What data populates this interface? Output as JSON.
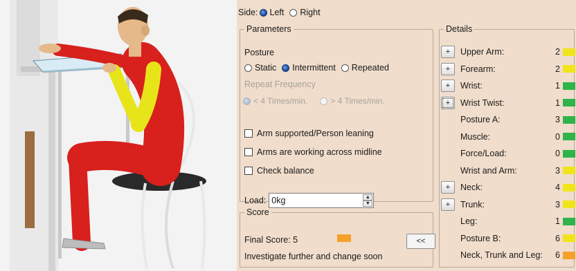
{
  "side": {
    "label": "Side:",
    "options": [
      {
        "label": "Left",
        "selected": true
      },
      {
        "label": "Right",
        "selected": false
      }
    ]
  },
  "parameters": {
    "legend": "Parameters",
    "posture": {
      "label": "Posture",
      "options": [
        {
          "label": "Static",
          "selected": false
        },
        {
          "label": "Intermittent",
          "selected": true
        },
        {
          "label": "Repeated",
          "selected": false
        }
      ]
    },
    "repeat_frequency": {
      "label": "Repeat Frequency",
      "enabled": false,
      "options": [
        {
          "label": "< 4 Times/min.",
          "selected": true
        },
        {
          "label": "> 4 Times/min.",
          "selected": false
        }
      ]
    },
    "checks": [
      {
        "label": "Arm supported/Person leaning",
        "checked": false
      },
      {
        "label": "Arms are working across midline",
        "checked": false
      },
      {
        "label": "Check balance",
        "checked": false
      }
    ],
    "load": {
      "label": "Load:",
      "value": "0kg"
    }
  },
  "score": {
    "legend": "Score",
    "final_label": "Final Score: 5",
    "color": "#f4a12c",
    "message": "Investigate further and change soon",
    "collapse_label": "<<"
  },
  "details": {
    "legend": "Details",
    "items": [
      {
        "label": "Upper Arm:",
        "value": "2",
        "color": "#f2e41b",
        "has_button": true
      },
      {
        "label": "Forearm:",
        "value": "2",
        "color": "#f2e41b",
        "has_button": true
      },
      {
        "label": "Wrist:",
        "value": "1",
        "color": "#2fb34a",
        "has_button": true
      },
      {
        "label": "Wrist Twist:",
        "value": "1",
        "color": "#2fb34a",
        "has_button": true,
        "focused": true
      },
      {
        "label": "Posture A:",
        "value": "3",
        "color": "#2fb34a",
        "has_button": false
      },
      {
        "label": "Muscle:",
        "value": "0",
        "color": "#2fb34a",
        "has_button": false
      },
      {
        "label": "Force/Load:",
        "value": "0",
        "color": "#2fb34a",
        "has_button": false
      },
      {
        "label": "Wrist and Arm:",
        "value": "3",
        "color": "#f2e41b",
        "has_button": false
      },
      {
        "label": "Neck:",
        "value": "4",
        "color": "#f2e41b",
        "has_button": true
      },
      {
        "label": "Trunk:",
        "value": "3",
        "color": "#f2e41b",
        "has_button": true
      },
      {
        "label": "Leg:",
        "value": "1",
        "color": "#2fb34a",
        "has_button": false
      },
      {
        "label": "Posture B:",
        "value": "6",
        "color": "#f2e41b",
        "has_button": false
      },
      {
        "label": "Neck, Trunk and Leg:",
        "value": "6",
        "color": "#f4a12c",
        "has_button": false
      }
    ],
    "button_label": "+"
  },
  "colors": {
    "panel_bg": "#f0ddcb",
    "manikin_red": "#d8201c",
    "manikin_yellow": "#e8e41a"
  }
}
